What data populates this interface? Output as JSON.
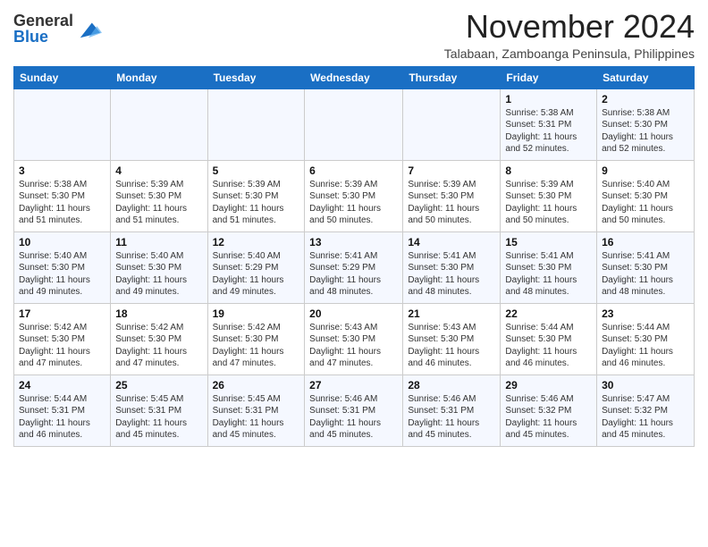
{
  "header": {
    "logo_general": "General",
    "logo_blue": "Blue",
    "month_title": "November 2024",
    "location": "Talabaan, Zamboanga Peninsula, Philippines"
  },
  "weekdays": [
    "Sunday",
    "Monday",
    "Tuesday",
    "Wednesday",
    "Thursday",
    "Friday",
    "Saturday"
  ],
  "weeks": [
    [
      {
        "day": "",
        "info": ""
      },
      {
        "day": "",
        "info": ""
      },
      {
        "day": "",
        "info": ""
      },
      {
        "day": "",
        "info": ""
      },
      {
        "day": "",
        "info": ""
      },
      {
        "day": "1",
        "info": "Sunrise: 5:38 AM\nSunset: 5:31 PM\nDaylight: 11 hours and 52 minutes."
      },
      {
        "day": "2",
        "info": "Sunrise: 5:38 AM\nSunset: 5:30 PM\nDaylight: 11 hours and 52 minutes."
      }
    ],
    [
      {
        "day": "3",
        "info": "Sunrise: 5:38 AM\nSunset: 5:30 PM\nDaylight: 11 hours and 51 minutes."
      },
      {
        "day": "4",
        "info": "Sunrise: 5:39 AM\nSunset: 5:30 PM\nDaylight: 11 hours and 51 minutes."
      },
      {
        "day": "5",
        "info": "Sunrise: 5:39 AM\nSunset: 5:30 PM\nDaylight: 11 hours and 51 minutes."
      },
      {
        "day": "6",
        "info": "Sunrise: 5:39 AM\nSunset: 5:30 PM\nDaylight: 11 hours and 50 minutes."
      },
      {
        "day": "7",
        "info": "Sunrise: 5:39 AM\nSunset: 5:30 PM\nDaylight: 11 hours and 50 minutes."
      },
      {
        "day": "8",
        "info": "Sunrise: 5:39 AM\nSunset: 5:30 PM\nDaylight: 11 hours and 50 minutes."
      },
      {
        "day": "9",
        "info": "Sunrise: 5:40 AM\nSunset: 5:30 PM\nDaylight: 11 hours and 50 minutes."
      }
    ],
    [
      {
        "day": "10",
        "info": "Sunrise: 5:40 AM\nSunset: 5:30 PM\nDaylight: 11 hours and 49 minutes."
      },
      {
        "day": "11",
        "info": "Sunrise: 5:40 AM\nSunset: 5:30 PM\nDaylight: 11 hours and 49 minutes."
      },
      {
        "day": "12",
        "info": "Sunrise: 5:40 AM\nSunset: 5:29 PM\nDaylight: 11 hours and 49 minutes."
      },
      {
        "day": "13",
        "info": "Sunrise: 5:41 AM\nSunset: 5:29 PM\nDaylight: 11 hours and 48 minutes."
      },
      {
        "day": "14",
        "info": "Sunrise: 5:41 AM\nSunset: 5:30 PM\nDaylight: 11 hours and 48 minutes."
      },
      {
        "day": "15",
        "info": "Sunrise: 5:41 AM\nSunset: 5:30 PM\nDaylight: 11 hours and 48 minutes."
      },
      {
        "day": "16",
        "info": "Sunrise: 5:41 AM\nSunset: 5:30 PM\nDaylight: 11 hours and 48 minutes."
      }
    ],
    [
      {
        "day": "17",
        "info": "Sunrise: 5:42 AM\nSunset: 5:30 PM\nDaylight: 11 hours and 47 minutes."
      },
      {
        "day": "18",
        "info": "Sunrise: 5:42 AM\nSunset: 5:30 PM\nDaylight: 11 hours and 47 minutes."
      },
      {
        "day": "19",
        "info": "Sunrise: 5:42 AM\nSunset: 5:30 PM\nDaylight: 11 hours and 47 minutes."
      },
      {
        "day": "20",
        "info": "Sunrise: 5:43 AM\nSunset: 5:30 PM\nDaylight: 11 hours and 47 minutes."
      },
      {
        "day": "21",
        "info": "Sunrise: 5:43 AM\nSunset: 5:30 PM\nDaylight: 11 hours and 46 minutes."
      },
      {
        "day": "22",
        "info": "Sunrise: 5:44 AM\nSunset: 5:30 PM\nDaylight: 11 hours and 46 minutes."
      },
      {
        "day": "23",
        "info": "Sunrise: 5:44 AM\nSunset: 5:30 PM\nDaylight: 11 hours and 46 minutes."
      }
    ],
    [
      {
        "day": "24",
        "info": "Sunrise: 5:44 AM\nSunset: 5:31 PM\nDaylight: 11 hours and 46 minutes."
      },
      {
        "day": "25",
        "info": "Sunrise: 5:45 AM\nSunset: 5:31 PM\nDaylight: 11 hours and 45 minutes."
      },
      {
        "day": "26",
        "info": "Sunrise: 5:45 AM\nSunset: 5:31 PM\nDaylight: 11 hours and 45 minutes."
      },
      {
        "day": "27",
        "info": "Sunrise: 5:46 AM\nSunset: 5:31 PM\nDaylight: 11 hours and 45 minutes."
      },
      {
        "day": "28",
        "info": "Sunrise: 5:46 AM\nSunset: 5:31 PM\nDaylight: 11 hours and 45 minutes."
      },
      {
        "day": "29",
        "info": "Sunrise: 5:46 AM\nSunset: 5:32 PM\nDaylight: 11 hours and 45 minutes."
      },
      {
        "day": "30",
        "info": "Sunrise: 5:47 AM\nSunset: 5:32 PM\nDaylight: 11 hours and 45 minutes."
      }
    ]
  ]
}
